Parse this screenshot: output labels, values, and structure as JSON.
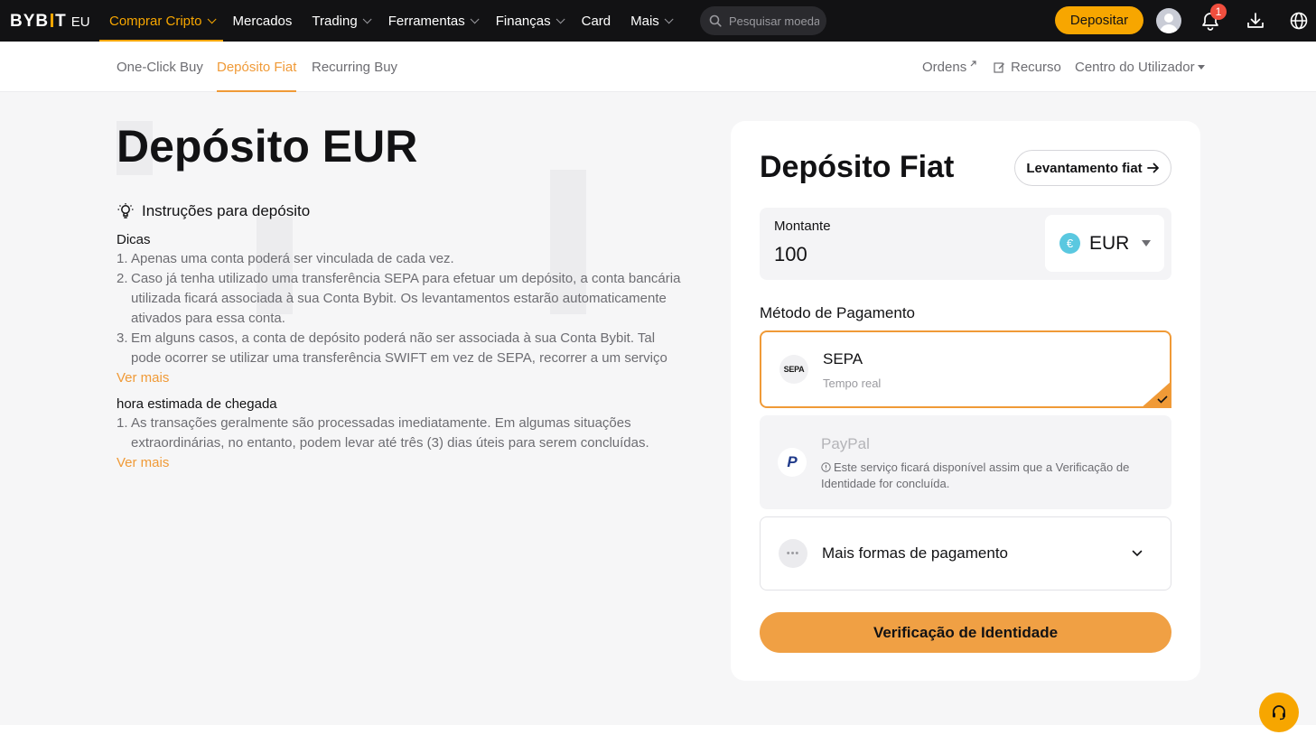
{
  "brand": {
    "logo_text": "BYBIT",
    "region": "EU"
  },
  "topnav": {
    "items": [
      {
        "label": "Comprar Cripto",
        "has_caret": true,
        "active": true
      },
      {
        "label": "Mercados",
        "has_caret": false
      },
      {
        "label": "Trading",
        "has_caret": true
      },
      {
        "label": "Ferramentas",
        "has_caret": true
      },
      {
        "label": "Finanças",
        "has_caret": true
      },
      {
        "label": "Card",
        "has_caret": false
      },
      {
        "label": "Mais",
        "has_caret": true
      }
    ],
    "search_placeholder": "Pesquisar moedas",
    "deposit_label": "Depositar",
    "notification_count": "1"
  },
  "subnav": {
    "tabs": [
      {
        "label": "One-Click Buy"
      },
      {
        "label": "Depósito Fiat",
        "active": true
      },
      {
        "label": "Recurring Buy"
      }
    ],
    "right": {
      "orders": "Ordens",
      "resource": "Recurso",
      "user_center": "Centro do Utilizador"
    }
  },
  "main": {
    "title": "Depósito EUR",
    "instructions_title": "Instruções para depósito",
    "tips": {
      "title": "Dicas",
      "items": [
        {
          "num": "1.",
          "lines": [
            "Apenas uma conta poderá ser vinculada de cada vez."
          ]
        },
        {
          "num": "2.",
          "lines": [
            "Caso já tenha utilizado uma transferência SEPA para efetuar um depósito, a conta bancária",
            "utilizada ficará associada à sua Conta Bybit. Os levantamentos estarão automaticamente",
            "ativados para essa conta."
          ]
        },
        {
          "num": "3.",
          "lines": [
            "Em alguns casos, a conta de depósito poderá não ser associada à sua Conta Bybit. Tal",
            "pode ocorrer se utilizar uma transferência SWIFT em vez de SEPA, recorrer a um serviço"
          ]
        }
      ],
      "see_more": "Ver mais"
    },
    "eta": {
      "title": "hora estimada de chegada",
      "items": [
        {
          "num": "1.",
          "lines": [
            "As transações geralmente são processadas imediatamente. Em algumas situações",
            "extraordinárias, no entanto, podem levar até três (3) dias úteis para serem concluídas."
          ]
        }
      ],
      "see_more": "Ver mais"
    }
  },
  "card": {
    "title": "Depósito Fiat",
    "withdraw_label": "Levantamento fiat",
    "amount_label": "Montante",
    "amount_value": "100",
    "currency": {
      "code": "EUR",
      "symbol": "€",
      "color": "#5ac8e0"
    },
    "payment_method_label": "Método de Pagamento",
    "methods": [
      {
        "name": "SEPA",
        "logo": "SEPA",
        "sub": "Tempo real",
        "selected": true
      },
      {
        "name": "PayPal",
        "logo": "P",
        "sub": "Este serviço ficará disponível assim que a Verificação de Identidade for concluída.",
        "disabled": true
      },
      {
        "name": "Mais formas de pagamento",
        "logo": "•••",
        "expandable": true
      }
    ],
    "verify_label": "Verificação de Identidade"
  },
  "colors": {
    "accent": "#f7a600",
    "accent_soft": "#f09a37",
    "nav_bg": "#121214"
  }
}
